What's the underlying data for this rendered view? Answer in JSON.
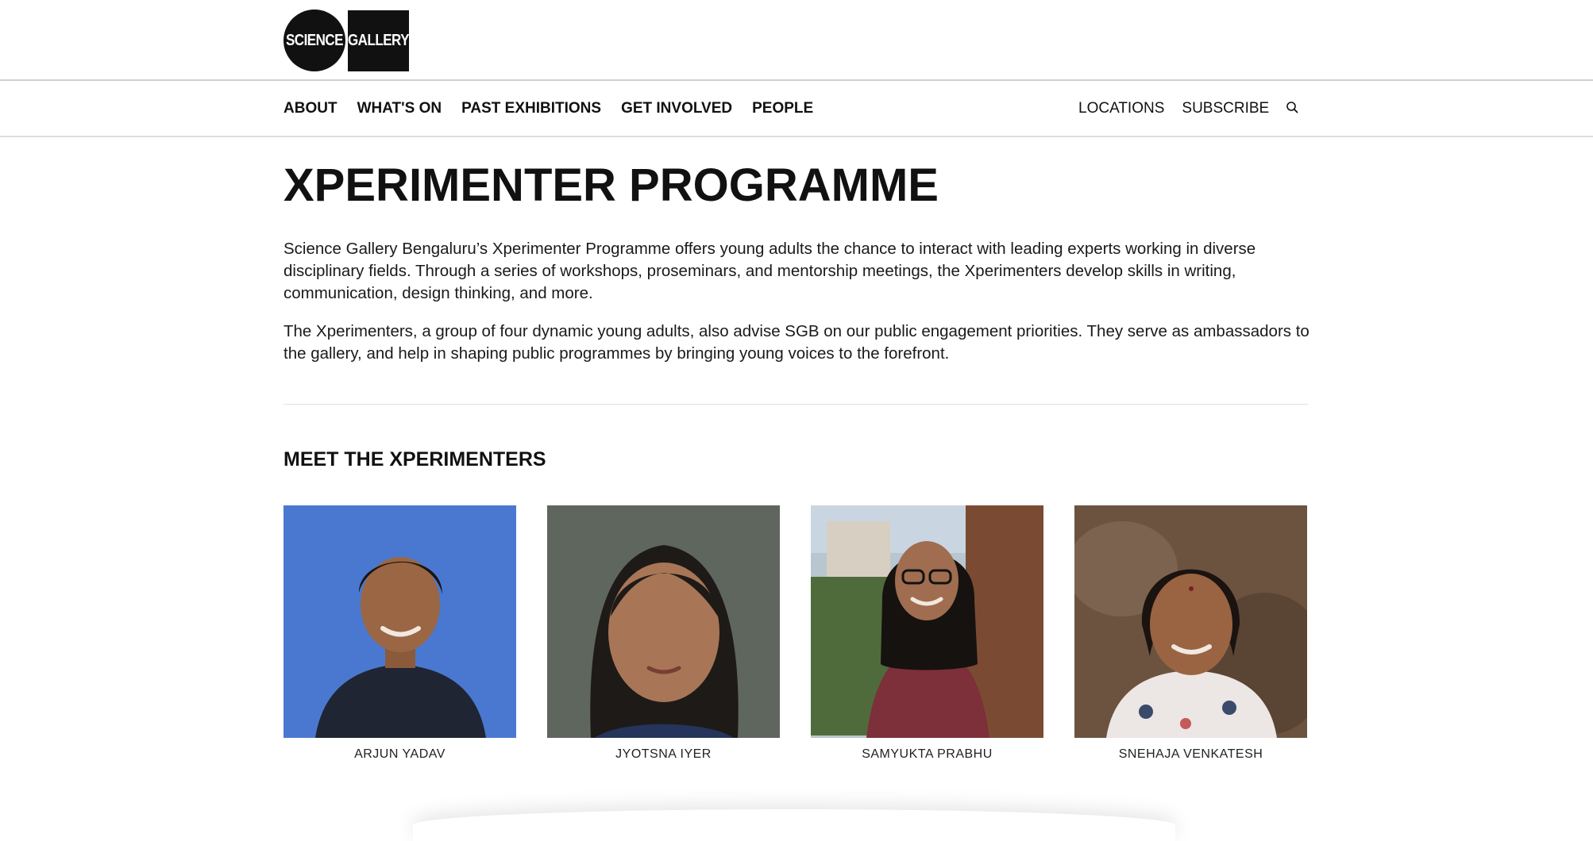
{
  "logo": {
    "left_text": "SCIENCE",
    "right_text": "GALLERY"
  },
  "nav": {
    "primary": [
      {
        "label": "ABOUT"
      },
      {
        "label": "WHAT'S ON"
      },
      {
        "label": "PAST EXHIBITIONS"
      },
      {
        "label": "GET INVOLVED"
      },
      {
        "label": "PEOPLE"
      }
    ],
    "locations_label": "LOCATIONS",
    "subscribe_label": "SUBSCRIBE",
    "search_icon": "search-icon"
  },
  "page": {
    "title": "XPERIMENTER PROGRAMME",
    "paragraphs": [
      "Science Gallery Bengaluru’s Xperimenter Programme offers young adults the chance to interact with leading experts working in diverse disciplinary fields. Through a series of workshops, proseminars, and mentorship meetings, the Xperimenters develop skills in writing, communication, design thinking, and more.",
      "The Xperimenters, a group of four dynamic young adults, also advise SGB on our public engagement priorities. They serve as ambassadors to the gallery, and help in shaping public programmes by bringing young voices to the forefront."
    ]
  },
  "section": {
    "title": "MEET THE XPERIMENTERS",
    "people": [
      {
        "name": "ARJUN YADAV",
        "background": "#4a78d0"
      },
      {
        "name": "JYOTSNA IYER",
        "background": "#5f665e"
      },
      {
        "name": "SAMYUKTA PRABHU",
        "background": "#9aa7a6"
      },
      {
        "name": "SNEHAJA VENKATESH",
        "background": "#6b5340"
      }
    ]
  },
  "colors": {
    "text": "#111111",
    "divider": "#e2e2e2"
  }
}
